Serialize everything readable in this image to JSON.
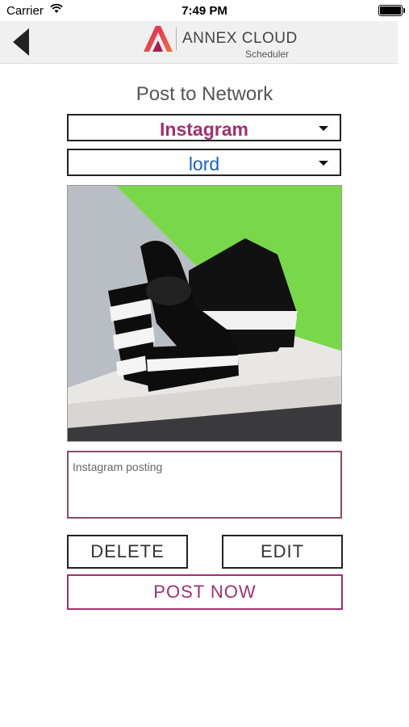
{
  "status_bar": {
    "carrier": "Carrier",
    "time": "7:49 PM"
  },
  "header": {
    "brand": "ANNEX CLOUD",
    "subtitle": "Scheduler",
    "logo_color": "#e0245e"
  },
  "page": {
    "heading": "Post to Network"
  },
  "network_select": {
    "value": "Instagram",
    "color": "#a0306f"
  },
  "account_select": {
    "value": "lord",
    "color": "#1a5fd0"
  },
  "caption": {
    "value": "Instagram posting"
  },
  "buttons": {
    "delete": "DELETE",
    "edit": "EDIT",
    "post_now": "POST NOW"
  },
  "icons": [
    "back-arrow-icon",
    "wifi-icon",
    "battery-icon",
    "dropdown-caret-icon",
    "annex-cloud-logo"
  ]
}
